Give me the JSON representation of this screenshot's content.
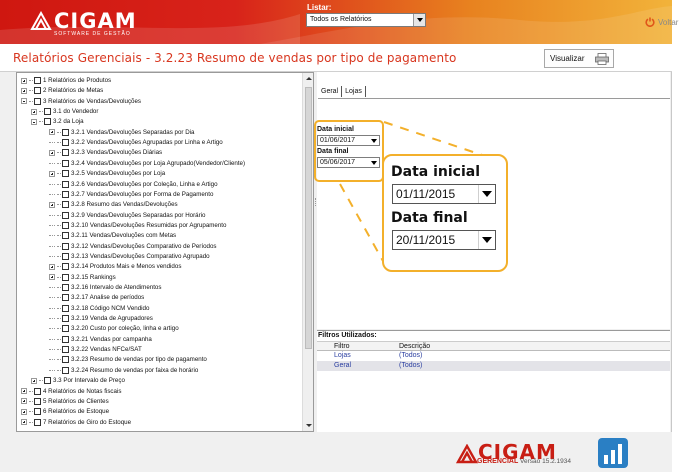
{
  "header": {
    "brand": "CIGAM",
    "brand_sub": "SOFTWARE DE GESTÃO",
    "listar_label": "Listar:",
    "listar_value": "Todos os Relatórios"
  },
  "title": {
    "text": "Relatórios Gerenciais - 3.2.23 Resumo de vendas por tipo de pagamento",
    "visualizar": "Visualizar"
  },
  "voltar": "Voltar",
  "tree": [
    {
      "label": "1 Relatórios de Produtos",
      "level": 0,
      "exp": "plus"
    },
    {
      "label": "2 Relatórios de Metas",
      "level": 0,
      "exp": "plus"
    },
    {
      "label": "3 Relatórios de Vendas/Devoluções",
      "level": 0,
      "exp": "minus"
    },
    {
      "label": "3.1 do Vendedor",
      "level": 1,
      "exp": "plus"
    },
    {
      "label": "3.2 da Loja",
      "level": 1,
      "exp": "minus"
    },
    {
      "label": "3.2.1 Vendas/Devoluções Separadas por Dia",
      "level": 2,
      "exp": "plus"
    },
    {
      "label": "3.2.2 Vendas/Devoluções Agrupadas por Linha e Artigo",
      "level": 2,
      "exp": "none"
    },
    {
      "label": "3.2.3 Vendas/Devoluções Diárias",
      "level": 2,
      "exp": "plus"
    },
    {
      "label": "3.2.4 Vendas/Devoluções por Loja Agrupado(Vendedor/Cliente)",
      "level": 2,
      "exp": "none"
    },
    {
      "label": "3.2.5 Vendas/Devoluções por Loja",
      "level": 2,
      "exp": "plus"
    },
    {
      "label": "3.2.6 Vendas/Devoluções por Coleção, Linha e Artigo",
      "level": 2,
      "exp": "none"
    },
    {
      "label": "3.2.7 Vendas/Devoluções por Forma de Pagamento",
      "level": 2,
      "exp": "none"
    },
    {
      "label": "3.2.8 Resumo das Vendas/Devoluções",
      "level": 2,
      "exp": "plus"
    },
    {
      "label": "3.2.9 Vendas/Devoluções Separadas por Horário",
      "level": 2,
      "exp": "none"
    },
    {
      "label": "3.2.10 Vendas/Devoluções Resumidas por Agrupamento",
      "level": 2,
      "exp": "none"
    },
    {
      "label": "3.2.11 Vendas/Devoluções com Metas",
      "level": 2,
      "exp": "none"
    },
    {
      "label": "3.2.12 Vendas/Devoluções Comparativo de Períodos",
      "level": 2,
      "exp": "none"
    },
    {
      "label": "3.2.13 Vendas/Devoluções Comparativo Agrupado",
      "level": 2,
      "exp": "none"
    },
    {
      "label": "3.2.14 Produtos Mais e Menos vendidos",
      "level": 2,
      "exp": "plus"
    },
    {
      "label": "3.2.15 Rankings",
      "level": 2,
      "exp": "plus"
    },
    {
      "label": "3.2.16 Intervalo de Atendimentos",
      "level": 2,
      "exp": "none"
    },
    {
      "label": "3.2.17 Analise de períodos",
      "level": 2,
      "exp": "none"
    },
    {
      "label": "3.2.18 Código NCM Vendido",
      "level": 2,
      "exp": "none"
    },
    {
      "label": "3.2.19 Venda de Agrupadores",
      "level": 2,
      "exp": "none"
    },
    {
      "label": "3.2.20 Custo por coleção, linha e artigo",
      "level": 2,
      "exp": "none"
    },
    {
      "label": "3.2.21 Vendas por campanha",
      "level": 2,
      "exp": "none"
    },
    {
      "label": "3.2.22 Vendas NFCe/SAT",
      "level": 2,
      "exp": "none"
    },
    {
      "label": "3.2.23 Resumo de vendas por tipo de pagamento",
      "level": 2,
      "exp": "none"
    },
    {
      "label": "3.2.24 Resumo de vendas por faixa de horário",
      "level": 2,
      "exp": "none"
    },
    {
      "label": "3.3 Por Intervalo de Preço",
      "level": 1,
      "exp": "plus"
    },
    {
      "label": "4 Relatórios de Notas fiscais",
      "level": 0,
      "exp": "plus"
    },
    {
      "label": "5 Relatórios de Clientes",
      "level": 0,
      "exp": "plus"
    },
    {
      "label": "6 Relatórios de Estoque",
      "level": 0,
      "exp": "plus"
    },
    {
      "label": "7 Relatórios de Giro do Estoque",
      "level": 0,
      "exp": "plus"
    }
  ],
  "tabs": [
    "Geral",
    "Lojas"
  ],
  "form": {
    "data_inicial_label": "Data inicial",
    "data_inicial_value": "01/06/2017",
    "data_final_label": "Data final",
    "data_final_value": "05/06/2017"
  },
  "zoom": {
    "data_inicial_label": "Data inicial",
    "data_inicial_value": "01/11/2015",
    "data_final_label": "Data final",
    "data_final_value": "20/11/2015"
  },
  "filters": {
    "title": "Filtros Utilizados:",
    "col_filtro": "Filtro",
    "col_descricao": "Descrição",
    "rows": [
      {
        "filtro": "Lojas",
        "descricao": "(Todos)"
      },
      {
        "filtro": "Geral",
        "descricao": "(Todos)"
      }
    ]
  },
  "footer": {
    "brand": "CIGAM",
    "gerencial": "GERENCIAL",
    "versao": "Versão 15.2.1934"
  },
  "colors": {
    "title_red": "#d8361f",
    "highlight_yellow": "#f3b02b",
    "filter_blue": "#2a3ea0"
  }
}
